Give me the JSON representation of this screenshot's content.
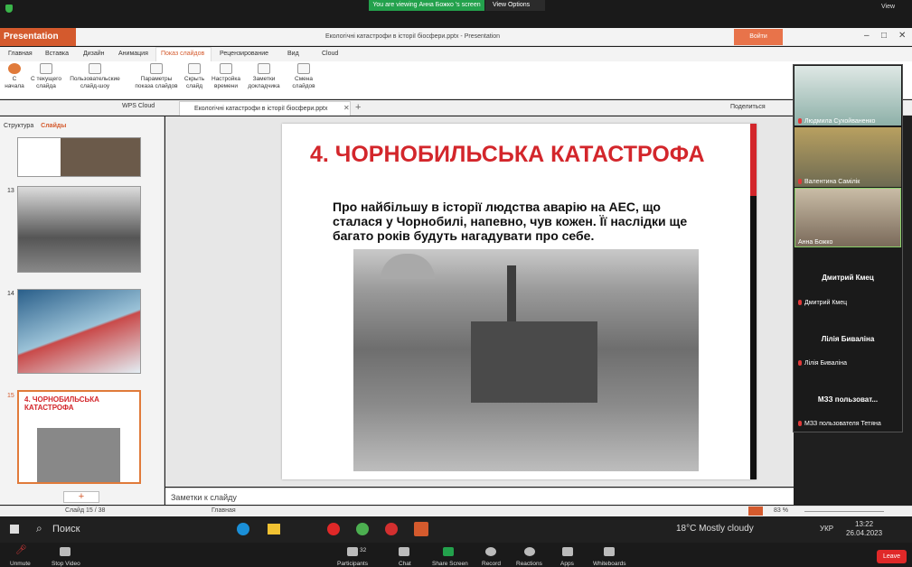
{
  "zoom": {
    "banner": "You are viewing Анна Божко 's screen",
    "view_options": "View Options",
    "view": "View",
    "bottom": {
      "unmute": "Unmute",
      "stop_video": "Stop Video",
      "participants": "Participants",
      "participants_count": "32",
      "chat": "Chat",
      "share_screen": "Share Screen",
      "record": "Record",
      "reactions": "Reactions",
      "apps": "Apps",
      "whiteboards": "Whiteboards",
      "leave": "Leave"
    },
    "participants": [
      {
        "name": "Людмила Сухойваненко"
      },
      {
        "name": "Валентина Самілік"
      },
      {
        "name": "Анна Божко"
      },
      {
        "big": "Дмитрий Кмец",
        "name": "Дмитрий Кмец"
      },
      {
        "big": "Лілія Биваліна",
        "name": "Лілія Биваліна"
      },
      {
        "big": "МЗЗ пользоват...",
        "name": "МЗЗ пользователя Тетяна"
      }
    ]
  },
  "wps": {
    "app": "Presentation",
    "doc_title": "Екологічні катастрофи в історії біосфери.pptx - Presentation",
    "login": "Войти",
    "menu": [
      "Главная",
      "Вставка",
      "Дизайн",
      "Анимация",
      "Показ слайдов",
      "Рецензирование",
      "Вид",
      "Cloud"
    ],
    "ribbon": [
      "С начала",
      "С текущего слайда",
      "Пользовательские слайд-шоу",
      "Параметры показа слайдов",
      "Скрыть слайд",
      "Настройка времени",
      "Заметки докладчика",
      "Смена слайдов"
    ],
    "wps_cloud": "WPS Cloud",
    "doc_tab": "Екологічні катастрофи в історії біосфери.pptx",
    "share": "Поделиться",
    "left_tabs": {
      "structure": "Структура",
      "slides": "Слайды"
    },
    "slide_numbers": [
      "13",
      "14",
      "15"
    ],
    "thumb15_title": "4. ЧОРНОБИЛЬСЬКА КАТАСТРОФА",
    "notes": "Заметки к слайду",
    "status": {
      "slide": "Слайд 15 / 38",
      "theme": "Главная",
      "zoom": "83 %"
    }
  },
  "slide": {
    "title": "4. ЧОРНОБИЛЬСЬКА КАТАСТРОФА",
    "text": "Про найбільшу в історії людства аварію на АЕС, що сталася у Чорнобилі, напевно, чув кожен. Її наслідки ще багато років будуть нагадувати про себе."
  },
  "taskbar": {
    "search": "Поиск",
    "weather": "18°C  Mostly cloudy",
    "lang": "УКР",
    "time": "13:22",
    "date": "26.04.2023"
  }
}
